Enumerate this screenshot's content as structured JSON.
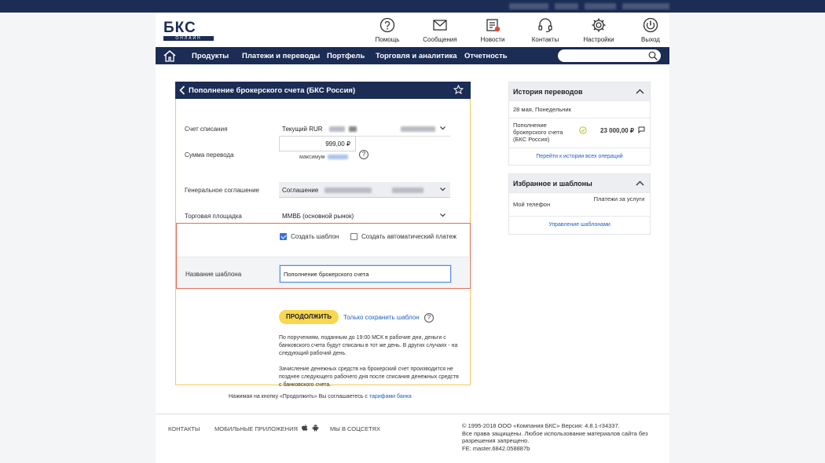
{
  "header": {
    "logo_text": "БКС",
    "logo_sub": "ОНЛАЙН",
    "icons": [
      {
        "icon": "question-icon",
        "label": "Помощь"
      },
      {
        "icon": "envelope-icon",
        "label": "Сообщения"
      },
      {
        "icon": "news-icon",
        "label": "Новости"
      },
      {
        "icon": "headset-icon",
        "label": "Контакты"
      },
      {
        "icon": "gear-icon",
        "label": "Настройки"
      },
      {
        "icon": "power-icon",
        "label": "Выход"
      }
    ]
  },
  "nav": {
    "items": [
      "Продукты",
      "Платежи и переводы",
      "Портфель",
      "Торговля и аналитика",
      "Отчетность"
    ],
    "search_placeholder": ""
  },
  "form": {
    "title": "Пополнение брокерского счета (БКС Россия)",
    "account_label": "Счет списания",
    "account_value": "Текущий RUR",
    "amount_label": "Сумма перевода",
    "amount_value": "999,00 ₽",
    "max_label": "максимум",
    "agreement_label": "Генеральное соглашение",
    "agreement_value": "Соглашение",
    "platform_label": "Торговая площадка",
    "platform_value": "ММВБ (основной рынок)",
    "create_template_label": "Создать шаблон",
    "create_template_checked": true,
    "auto_payment_label": "Создать автоматический платеж",
    "auto_payment_checked": false,
    "template_name_label": "Название шаблона",
    "template_name_value": "Пополнение брокерского счета",
    "continue_label": "ПРОДОЛЖИТЬ",
    "save_only_label": "Только сохранить шаблон",
    "info_1": "По поручениям, поданным до 19:00 МСК в рабочие дни, деньги с банковского счета будут списаны в тот же день. В других случаях - на следующий рабочий день.",
    "info_2": "Зачисление денежных средств на брокерский счет производится не позднее следующего рабочего дня после списания денежных средств с банковского счета."
  },
  "agree": {
    "text": "Нажимая на кнопку «Продолжить» Вы соглашаетесь с ",
    "link": "тарифами банка"
  },
  "history": {
    "title": "История переводов",
    "date": "28 мая, Понедельник",
    "item_desc": "Пополнение брокерского счета (БКС Россия)",
    "item_amount": "23 000,00 ₽",
    "link": "Перейти к истории всех операций"
  },
  "favorites": {
    "title": "Избранное и шаблоны",
    "item_1": "Мой телефон",
    "item_2": "Платежи за услуги",
    "link": "Управление шаблонами"
  },
  "footer": {
    "contacts": "КОНТАКТЫ",
    "apps": "МОБИЛЬНЫЕ ПРИЛОЖЕНИЯ",
    "social": "МЫ В СОЦСЕТЯХ",
    "copyright_1": "© 1995-2018 ООО «Компания БКС» Версия: 4.8.1-r34337.",
    "copyright_2": "Все права защищены. Любое использование материалов сайта без разрешения запрещено.",
    "copyright_3": "FE: master.6842.058887b"
  },
  "colors": {
    "navy": "#1b2c55",
    "accent_yellow": "#f9d74e",
    "highlight_red": "#e36b5c",
    "link_blue": "#1f5fc8"
  }
}
